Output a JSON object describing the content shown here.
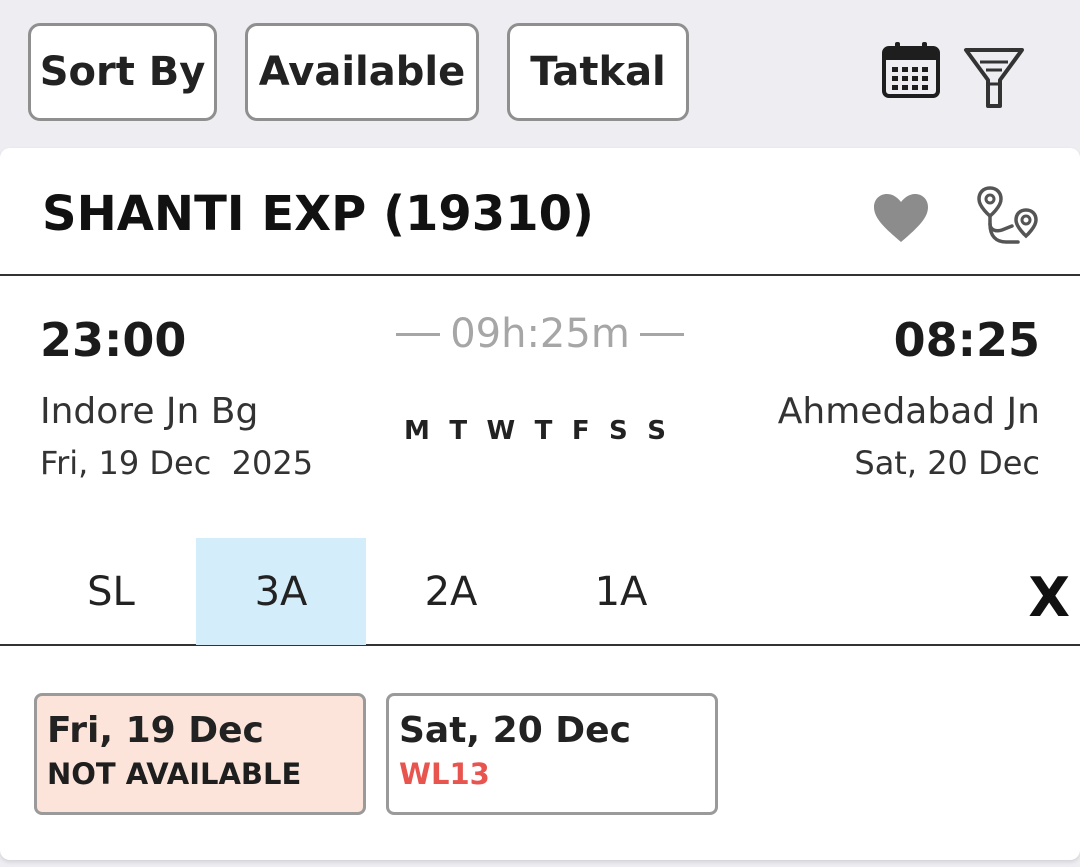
{
  "filters": {
    "sort_label": "Sort By",
    "available_label": "Available",
    "tatkal_label": "Tatkal"
  },
  "icons": {
    "calendar": "calendar-icon",
    "filter": "filter-funnel-icon",
    "favorite": "heart-icon",
    "route": "route-map-icon"
  },
  "train": {
    "title": "SHANTI EXP (19310)",
    "departure_time": "23:00",
    "arrival_time": "08:25",
    "duration": "09h:25m",
    "departure_station": "Indore Jn Bg",
    "departure_date": "Fri, 19 Dec  2025",
    "arrival_station": "Ahmedabad Jn",
    "arrival_date": "Sat, 20 Dec",
    "run_days": [
      "M",
      "T",
      "W",
      "T",
      "F",
      "S",
      "S"
    ]
  },
  "classes": {
    "items": [
      "SL",
      "3A",
      "2A",
      "1A"
    ],
    "selected": "3A",
    "close_label": "X"
  },
  "availability": [
    {
      "date": "Fri, 19 Dec",
      "status": "NOT AVAILABLE",
      "status_color": "#1e1e1e",
      "bg": "#fde4da"
    },
    {
      "date": "Sat, 20 Dec",
      "status": "WL13",
      "status_color": "#e8544e",
      "bg": "#ffffff"
    }
  ],
  "colors": {
    "selected_tab": "#d4edfa",
    "not_available_bg": "#fde4da",
    "waitlist_text": "#e8544e",
    "duration_text": "#a6a6a6"
  }
}
